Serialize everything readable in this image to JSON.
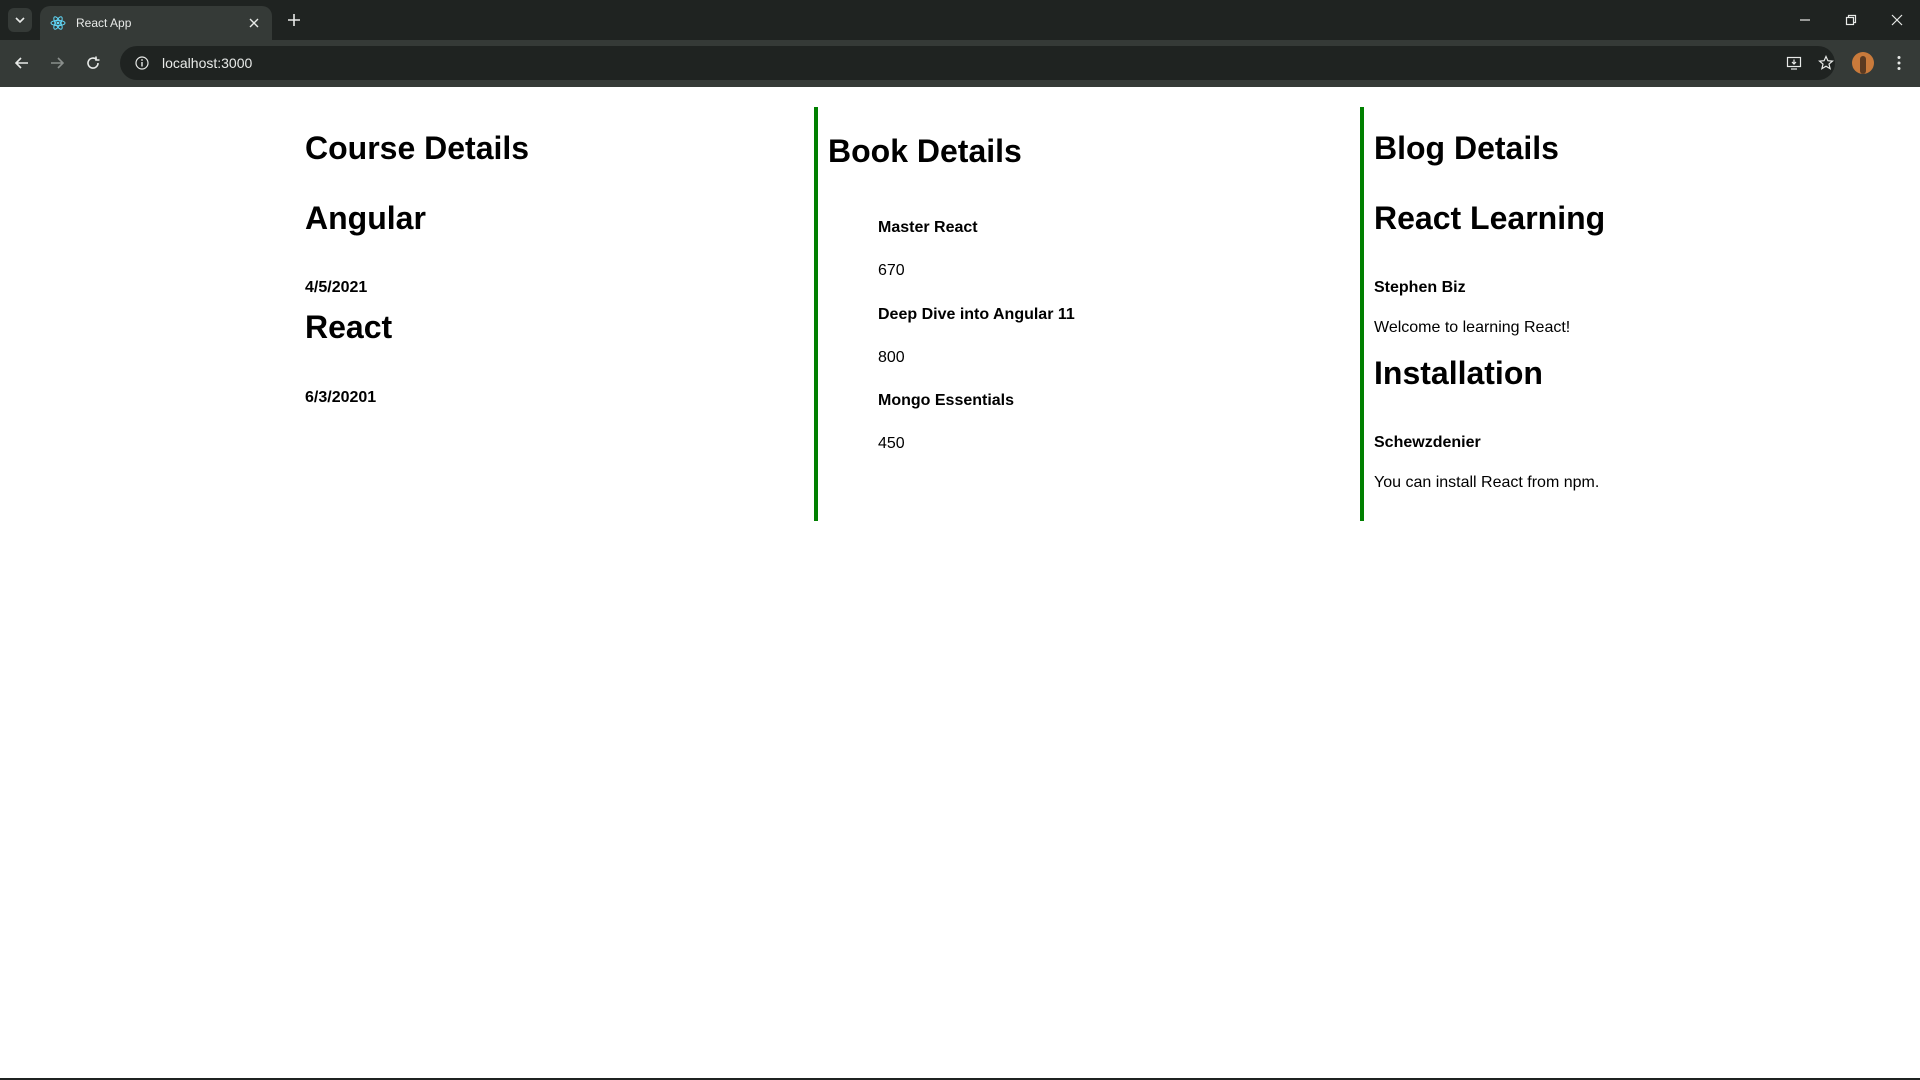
{
  "browser": {
    "tab_title": "React App",
    "url": "localhost:3000"
  },
  "course": {
    "heading": "Course Details",
    "items": [
      {
        "name": "Angular",
        "date": "4/5/2021"
      },
      {
        "name": "React",
        "date": "6/3/20201"
      }
    ]
  },
  "book": {
    "heading": "Book Details",
    "items": [
      {
        "name": "Master React",
        "price": "670"
      },
      {
        "name": "Deep Dive into Angular 11",
        "price": "800"
      },
      {
        "name": "Mongo Essentials",
        "price": "450"
      }
    ]
  },
  "blog": {
    "heading": "Blog Details",
    "items": [
      {
        "title": "React Learning",
        "author": "Stephen Biz",
        "text": "Welcome to learning React!"
      },
      {
        "title": "Installation",
        "author": "Schewzdenier",
        "text": "You can install React from npm."
      }
    ]
  },
  "colors": {
    "divider": "#008000",
    "chrome_dark": "#1f2321",
    "chrome_toolbar": "#353a37"
  }
}
